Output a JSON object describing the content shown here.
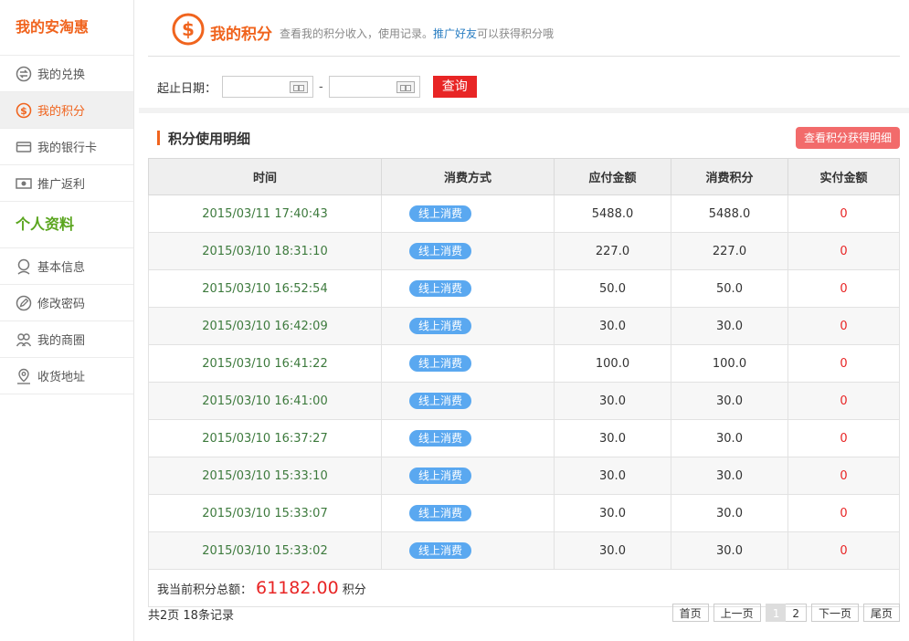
{
  "sidebar": {
    "section1_title": "我的安淘惠",
    "section1_items": [
      {
        "label": "我的兑换",
        "icon": "exchange-icon"
      },
      {
        "label": "我的积分",
        "icon": "dollar-icon"
      },
      {
        "label": "我的银行卡",
        "icon": "card-icon"
      },
      {
        "label": "推广返利",
        "icon": "money-icon"
      }
    ],
    "section2_title": "个人资料",
    "section2_items": [
      {
        "label": "基本信息",
        "icon": "user-icon"
      },
      {
        "label": "修改密码",
        "icon": "pencil-icon"
      },
      {
        "label": "我的商圈",
        "icon": "group-icon"
      },
      {
        "label": "收货地址",
        "icon": "location-icon"
      }
    ]
  },
  "header": {
    "title": "我的积分",
    "subtitle_prefix": "查看我的积分收入，使用记录。",
    "subtitle_link": "推广好友",
    "subtitle_suffix": "可以获得积分哦"
  },
  "filter": {
    "label": "起止日期：",
    "start_value": "",
    "end_value": "",
    "dash": "-",
    "query_label": "查询"
  },
  "detail": {
    "title": "积分使用明细",
    "earn_button": "查看积分获得明细",
    "columns": [
      "时间",
      "消费方式",
      "应付金额",
      "消费积分",
      "实付金额"
    ],
    "rows": [
      {
        "time": "2015/03/11 17:40:43",
        "method": "线上消费",
        "due": "5488.0",
        "points": "5488.0",
        "paid": "0"
      },
      {
        "time": "2015/03/10 18:31:10",
        "method": "线上消费",
        "due": "227.0",
        "points": "227.0",
        "paid": "0"
      },
      {
        "time": "2015/03/10 16:52:54",
        "method": "线上消费",
        "due": "50.0",
        "points": "50.0",
        "paid": "0"
      },
      {
        "time": "2015/03/10 16:42:09",
        "method": "线上消费",
        "due": "30.0",
        "points": "30.0",
        "paid": "0"
      },
      {
        "time": "2015/03/10 16:41:22",
        "method": "线上消费",
        "due": "100.0",
        "points": "100.0",
        "paid": "0"
      },
      {
        "time": "2015/03/10 16:41:00",
        "method": "线上消费",
        "due": "30.0",
        "points": "30.0",
        "paid": "0"
      },
      {
        "time": "2015/03/10 16:37:27",
        "method": "线上消费",
        "due": "30.0",
        "points": "30.0",
        "paid": "0"
      },
      {
        "time": "2015/03/10 15:33:10",
        "method": "线上消费",
        "due": "30.0",
        "points": "30.0",
        "paid": "0"
      },
      {
        "time": "2015/03/10 15:33:07",
        "method": "线上消费",
        "due": "30.0",
        "points": "30.0",
        "paid": "0"
      },
      {
        "time": "2015/03/10 15:33:02",
        "method": "线上消费",
        "due": "30.0",
        "points": "30.0",
        "paid": "0"
      }
    ],
    "total_label": "我当前积分总额：",
    "total_value": "61182.00",
    "total_unit": "积分"
  },
  "footer": {
    "summary": "共2页 18条记录",
    "pager": [
      "首页",
      "上一页",
      "1",
      "2",
      "下一页",
      "尾页"
    ],
    "current_page": "1"
  },
  "colors": {
    "accent_orange": "#f0641e",
    "accent_green": "#5aa51e",
    "red": "#e82525",
    "pill_blue": "#5aa8f0",
    "link_blue": "#2a7ec2"
  }
}
